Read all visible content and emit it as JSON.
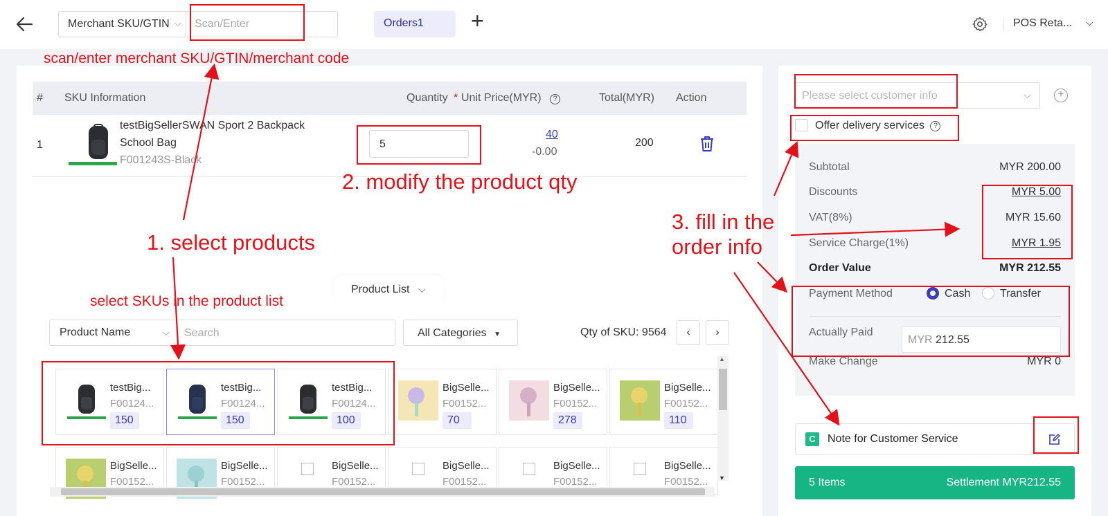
{
  "topbar": {
    "search_type": "Merchant SKU/GTIN",
    "scan_placeholder": "Scan/Enter",
    "order_tab": "Orders1",
    "add_label": "+",
    "store_name": "POS Reta..."
  },
  "cart": {
    "headers": {
      "index": "#",
      "sku": "SKU Information",
      "quantity": "Quantity",
      "required_mark": "*",
      "unit_price": "Unit Price(MYR)",
      "total": "Total(MYR)",
      "action": "Action"
    },
    "rows": [
      {
        "index": "1",
        "name_line1": "testBigSellerSWAN Sport 2 Backpack",
        "name_line2": "School Bag",
        "sku_code": "F001243S-Black",
        "quantity": "5",
        "unit_price": "40",
        "discount": "-0.00",
        "total": "200"
      }
    ]
  },
  "product_list": {
    "tab_label": "Product List",
    "filter_field": "Product Name",
    "search_placeholder": "Search",
    "category": "All Categories",
    "qty_of_sku": "Qty of SKU: 9564",
    "prev": "‹",
    "next": "›",
    "cards": [
      {
        "name": "testBig...",
        "code": "F00124...",
        "stock": "150",
        "image": "black-backpack"
      },
      {
        "name": "testBig...",
        "code": "F00124...",
        "stock": "150",
        "image": "navy-backpack"
      },
      {
        "name": "testBig...",
        "code": "F00124...",
        "stock": "100",
        "image": "black-backpack"
      },
      {
        "name": "BigSelle...",
        "code": "F00152...",
        "stock": "70",
        "image": "fan-yellow"
      },
      {
        "name": "BigSelle...",
        "code": "F00152...",
        "stock": "278",
        "image": "fan-pink"
      },
      {
        "name": "BigSelle...",
        "code": "F00152...",
        "stock": "110",
        "image": "fan-green"
      },
      {
        "name": "BigSelle...",
        "code": "F00152...",
        "image": "fan-green"
      },
      {
        "name": "BigSelle...",
        "code": "F00152...",
        "image": "fan-teal"
      },
      {
        "name": "BigSelle...",
        "code": "F00152...",
        "image": "broken-image"
      },
      {
        "name": "BigSelle...",
        "code": "F00152...",
        "image": "broken-image"
      },
      {
        "name": "BigSelle...",
        "code": "F00152...",
        "image": "broken-image"
      },
      {
        "name": "BigSelle...",
        "code": "F00152...",
        "image": "broken-image"
      }
    ]
  },
  "order": {
    "customer_placeholder": "Please select customer info",
    "delivery_label": "Offer delivery services",
    "subtotal_label": "Subtotal",
    "subtotal": "MYR 200.00",
    "discounts_label": "Discounts",
    "discounts": "MYR 5.00",
    "vat_label": "VAT(8%)",
    "vat": "MYR 15.60",
    "service_label": "Service Charge(1%)",
    "service": "MYR 1.95",
    "order_value_label": "Order Value",
    "order_value": "MYR 212.55",
    "payment_method_label": "Payment Method",
    "payment_options": [
      "Cash",
      "Transfer"
    ],
    "payment_selected": "Cash",
    "actually_paid_label": "Actually Paid",
    "currency": "MYR",
    "actually_paid": "212.55",
    "make_change_label": "Make Change",
    "make_change": "MYR 0",
    "note_badge": "C",
    "note_label": "Note for Customer Service",
    "items_count": "5 Items",
    "settlement": "Settlement MYR212.55"
  },
  "annotations": {
    "scan_hint": "scan/enter merchant SKU/GTIN/merchant code",
    "step1": "1. select products",
    "step1_sub": "select SKUs in the product list",
    "step2": "2. modify the product qty",
    "step3_line1": "3. fill in the",
    "step3_line2": "order info"
  },
  "colors": {
    "accent": "#3b3bbf",
    "settle_green": "#17b584",
    "annotation_red": "#e3121a"
  }
}
